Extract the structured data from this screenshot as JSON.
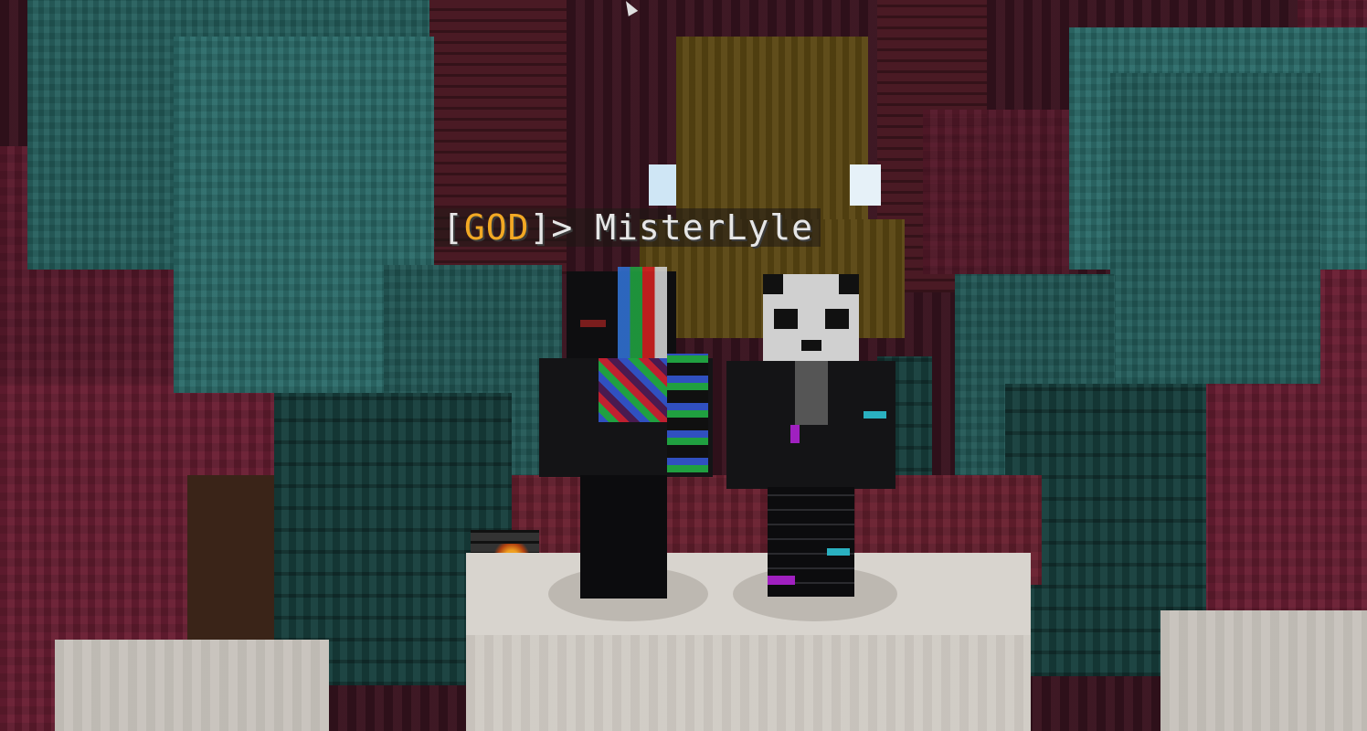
{
  "nametag": {
    "open": "[",
    "rank": "GOD",
    "close": "]> ",
    "player_name": "MisterLyle"
  },
  "colors": {
    "rank_gold": "#f2a824",
    "nametag_text": "#e6e6e6",
    "warped_teal": "#245e5c",
    "crimson_nylium": "#5a1a2c",
    "quartz_white": "#cfcac3",
    "shroomlight_gold": "#5a4612"
  },
  "scene": {
    "statue_left": "colorful-skin-statue",
    "statue_right": "panda-skin-statue",
    "pedestal": "quartz-pedestal"
  }
}
